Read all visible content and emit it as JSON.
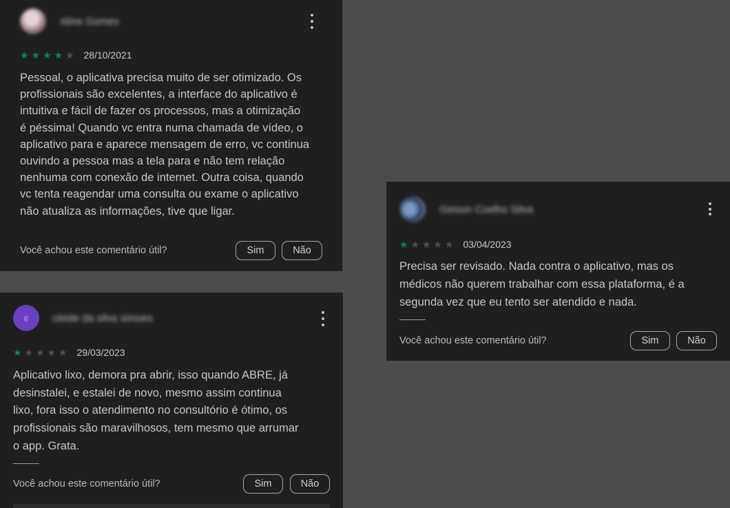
{
  "reviews": [
    {
      "user": "Aline Gomes",
      "rating": 4,
      "date": "28/10/2021",
      "text": "Pessoal, o aplicativa precisa muito de ser otimizado. Os profissionais são excelentes, a interface do aplicativo é intuitiva e fácil de fazer os processos, mas a otimização é péssima! Quando vc entra numa chamada de vídeo, o aplicativo para e aparece mensagem de erro, vc continua ouvindo a pessoa mas a tela para e não tem relação nenhuma com conexão de internet. Outra coisa, quando vc tenta reagendar uma consulta ou exame o aplicativo não atualiza as informações, tive que ligar.",
      "lines": [
        "Pessoal, o aplicativa precisa muito de ser otimizado. Os",
        "profissionais são excelentes, a interface do aplicativo é",
        "intuitiva e fácil de fazer os processos, mas a otimização",
        "é péssima! Quando vc entra numa chamada de vídeo, o",
        "aplicativo para e aparece mensagem de erro, vc continua",
        "ouvindo a pessoa mas a tela para e não tem relação",
        "nenhuma com conexão de internet. Outra coisa, quando",
        "vc tenta reagendar uma consulta ou exame o aplicativo",
        "não atualiza as informações, tive que ligar."
      ],
      "helpful_question": "Você achou este comentário útil?",
      "yes_label": "Sim",
      "no_label": "Não"
    },
    {
      "user": "cleide da silva simoes",
      "avatar_letter": "c",
      "rating": 1,
      "date": "29/03/2023",
      "lines": [
        "Aplicativo lixo, demora pra abrir, isso quando ABRE, já",
        "desinstalei, e estalei de novo, mesmo assim continua",
        "lixo, fora isso o atendimento no consultório é ótimo, os",
        "profissionais são maravilhosos, tem mesmo que arrumar",
        "o app. Grata."
      ],
      "helpful_question": "Você achou este comentário útil?",
      "yes_label": "Sim",
      "no_label": "Não"
    },
    {
      "user": "Geison Coelho Silva",
      "rating": 1,
      "date": "03/04/2023",
      "lines": [
        "Precisa ser revisado. Nada contra o aplicativo, mas os",
        "médicos não querem trabalhar com essa plataforma, é a",
        "segunda vez que eu tento ser atendido e nada."
      ],
      "helpful_question": "Você achou este comentário útil?",
      "yes_label": "Sim",
      "no_label": "Não"
    }
  ],
  "colors": {
    "background": "#4c4c4c",
    "card": "#1f1f1f",
    "star_filled": "#01875f",
    "star_empty": "#4e4e4e"
  },
  "icons": [
    "more-vert-icon",
    "star-icon"
  ]
}
